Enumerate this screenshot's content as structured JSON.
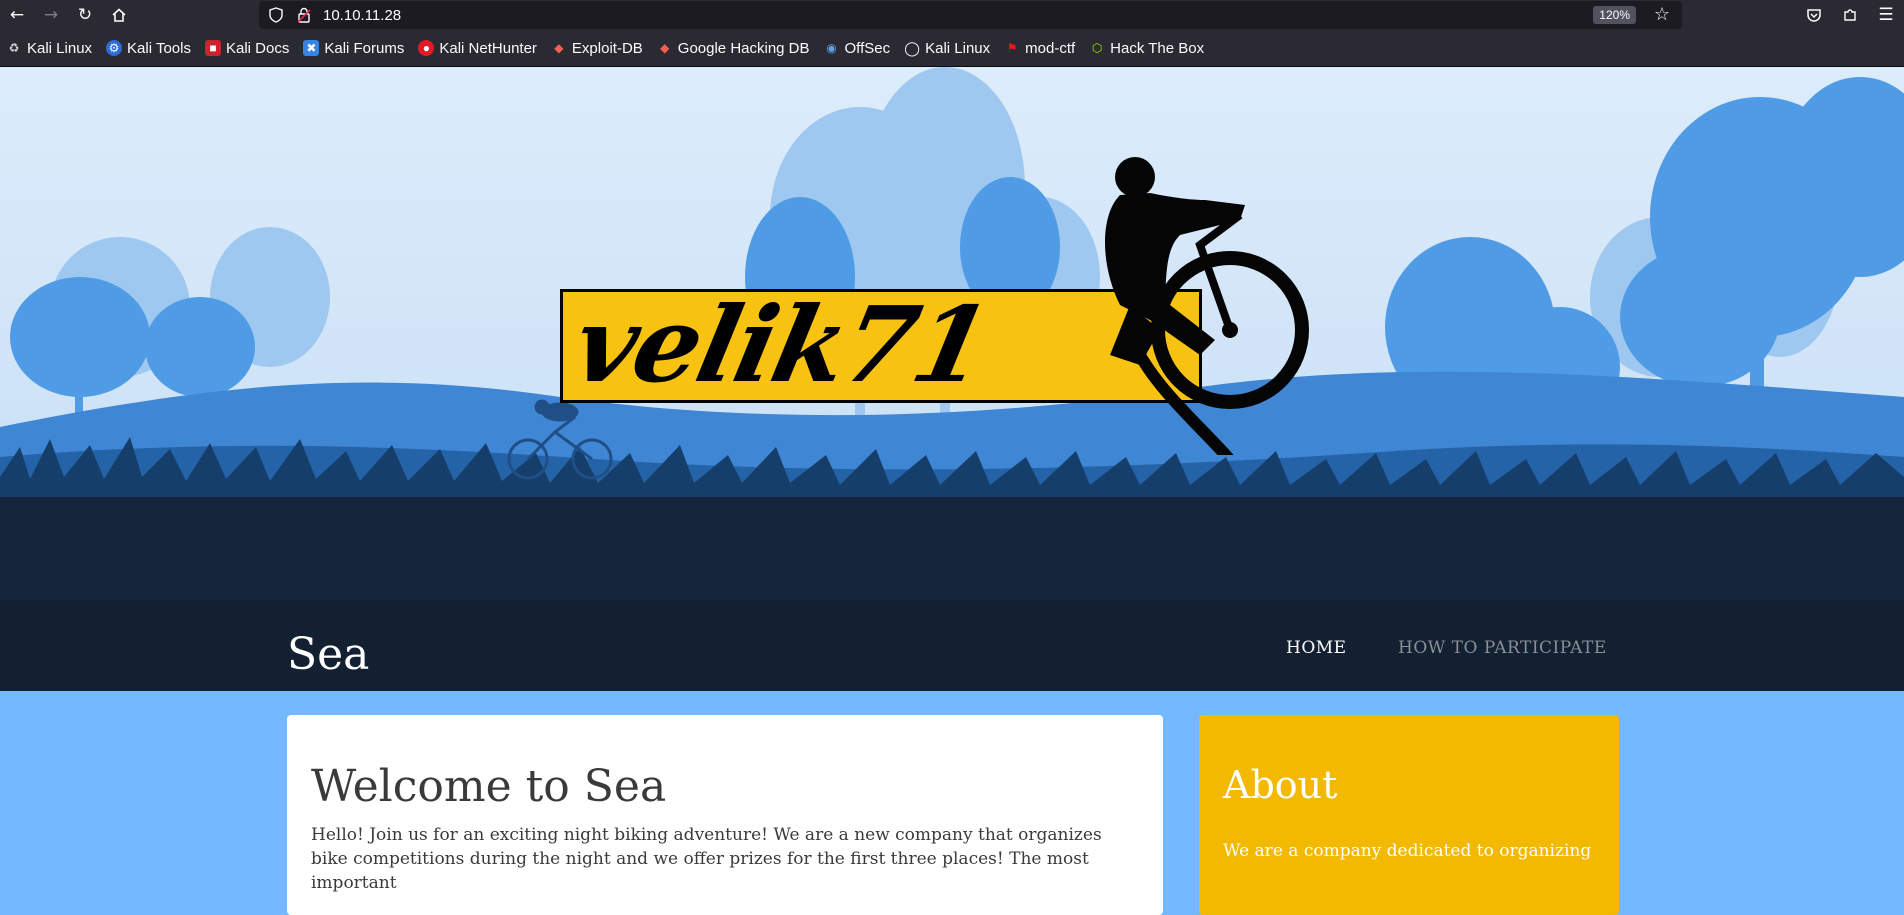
{
  "browser": {
    "url": "10.10.11.28",
    "zoom": "120%",
    "bookmarks": [
      {
        "label": "Kali Linux",
        "icon": "kali-dragon-icon"
      },
      {
        "label": "Kali Tools",
        "icon": "kali-tools-icon"
      },
      {
        "label": "Kali Docs",
        "icon": "kali-docs-icon"
      },
      {
        "label": "Kali Forums",
        "icon": "kali-forums-icon"
      },
      {
        "label": "Kali NetHunter",
        "icon": "kali-nethunter-icon"
      },
      {
        "label": "Exploit-DB",
        "icon": "exploit-db-icon"
      },
      {
        "label": "Google Hacking DB",
        "icon": "ghdb-icon"
      },
      {
        "label": "OffSec",
        "icon": "offsec-icon"
      },
      {
        "label": "Kali Linux",
        "icon": "globe-icon"
      },
      {
        "label": "mod-ctf",
        "icon": "mod-ctf-icon"
      },
      {
        "label": "Hack The Box",
        "icon": "hack-the-box-icon"
      }
    ]
  },
  "banner": {
    "logo_text": "velik71"
  },
  "site": {
    "title": "Sea",
    "nav": [
      {
        "label": "HOME"
      },
      {
        "label": "HOW TO PARTICIPATE"
      }
    ]
  },
  "main": {
    "heading": "Welcome to Sea",
    "body": "Hello! Join us for an exciting night biking adventure! We are a new company that organizes bike competitions during the night and we offer prizes for the first three places! The most important"
  },
  "sidebar": {
    "heading": "About",
    "body": "We are a company dedicated to organizing"
  },
  "colors": {
    "header_bg": "#122031",
    "page_bg": "#74b9ff",
    "about_bg": "#f3b800",
    "logo_yellow": "#f7c310"
  }
}
